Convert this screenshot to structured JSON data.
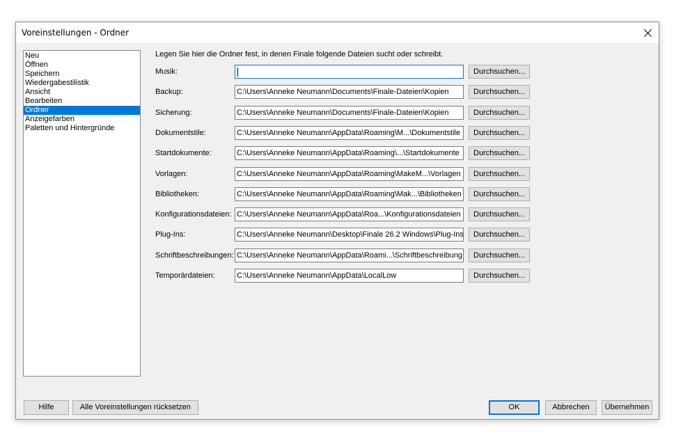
{
  "window": {
    "title": "Voreinstellungen - Ordner"
  },
  "sidebar": {
    "items": [
      {
        "label": "Neu",
        "selected": false
      },
      {
        "label": "Öffnen",
        "selected": false
      },
      {
        "label": "Speichern",
        "selected": false
      },
      {
        "label": "Wiedergabestilistik",
        "selected": false
      },
      {
        "label": "Ansicht",
        "selected": false
      },
      {
        "label": "Bearbeiten",
        "selected": false
      },
      {
        "label": "Ordner",
        "selected": true
      },
      {
        "label": "Anzeigefarben",
        "selected": false
      },
      {
        "label": "Paletten und Hintergründe",
        "selected": false
      }
    ]
  },
  "main": {
    "intro": "Legen Sie hier die Ordner fest, in denen Finale folgende Dateien sucht oder schreibt.",
    "browse_label": "Durchsuchen...",
    "folders": [
      {
        "label": "Musik:",
        "value": ""
      },
      {
        "label": "Backup:",
        "value": "C:\\Users\\Anneke Neumann\\Documents\\Finale-Dateien\\Kopien"
      },
      {
        "label": "Sicherung:",
        "value": "C:\\Users\\Anneke Neumann\\Documents\\Finale-Dateien\\Kopien"
      },
      {
        "label": "Dokumentstile:",
        "value": "C:\\Users\\Anneke Neumann\\AppData\\Roaming\\M...\\Dokumentstile"
      },
      {
        "label": "Startdokumente:",
        "value": "C:\\Users\\Anneke Neumann\\AppData\\Roaming\\...\\Startdokumente"
      },
      {
        "label": "Vorlagen:",
        "value": "C:\\Users\\Anneke Neumann\\AppData\\Roaming\\MakeM...\\Vorlagen"
      },
      {
        "label": "Bibliotheken:",
        "value": "C:\\Users\\Anneke Neumann\\AppData\\Roaming\\Mak...\\Bibliotheken"
      },
      {
        "label": "Konfigurationsdateien:",
        "value": "C:\\Users\\Anneke Neumann\\AppData\\Roa...\\Konfigurationsdateien"
      },
      {
        "label": "Plug-Ins:",
        "value": "C:\\Users\\Anneke Neumann\\Desktop\\Finale 26.2 Windows\\Plug-Ins"
      },
      {
        "label": "Schriftbeschreibungen:",
        "value": "C:\\Users\\Anneke Neumann\\AppData\\Roami...\\Schriftbeschreibung"
      },
      {
        "label": "Temporärdateien:",
        "value": "C:\\Users\\Anneke Neumann\\AppData\\LocalLow"
      }
    ]
  },
  "footer": {
    "help": "Hilfe",
    "reset_all": "Alle Voreinstellungen rücksetzen",
    "ok": "OK",
    "cancel": "Abbrechen",
    "apply": "Übernehmen"
  }
}
